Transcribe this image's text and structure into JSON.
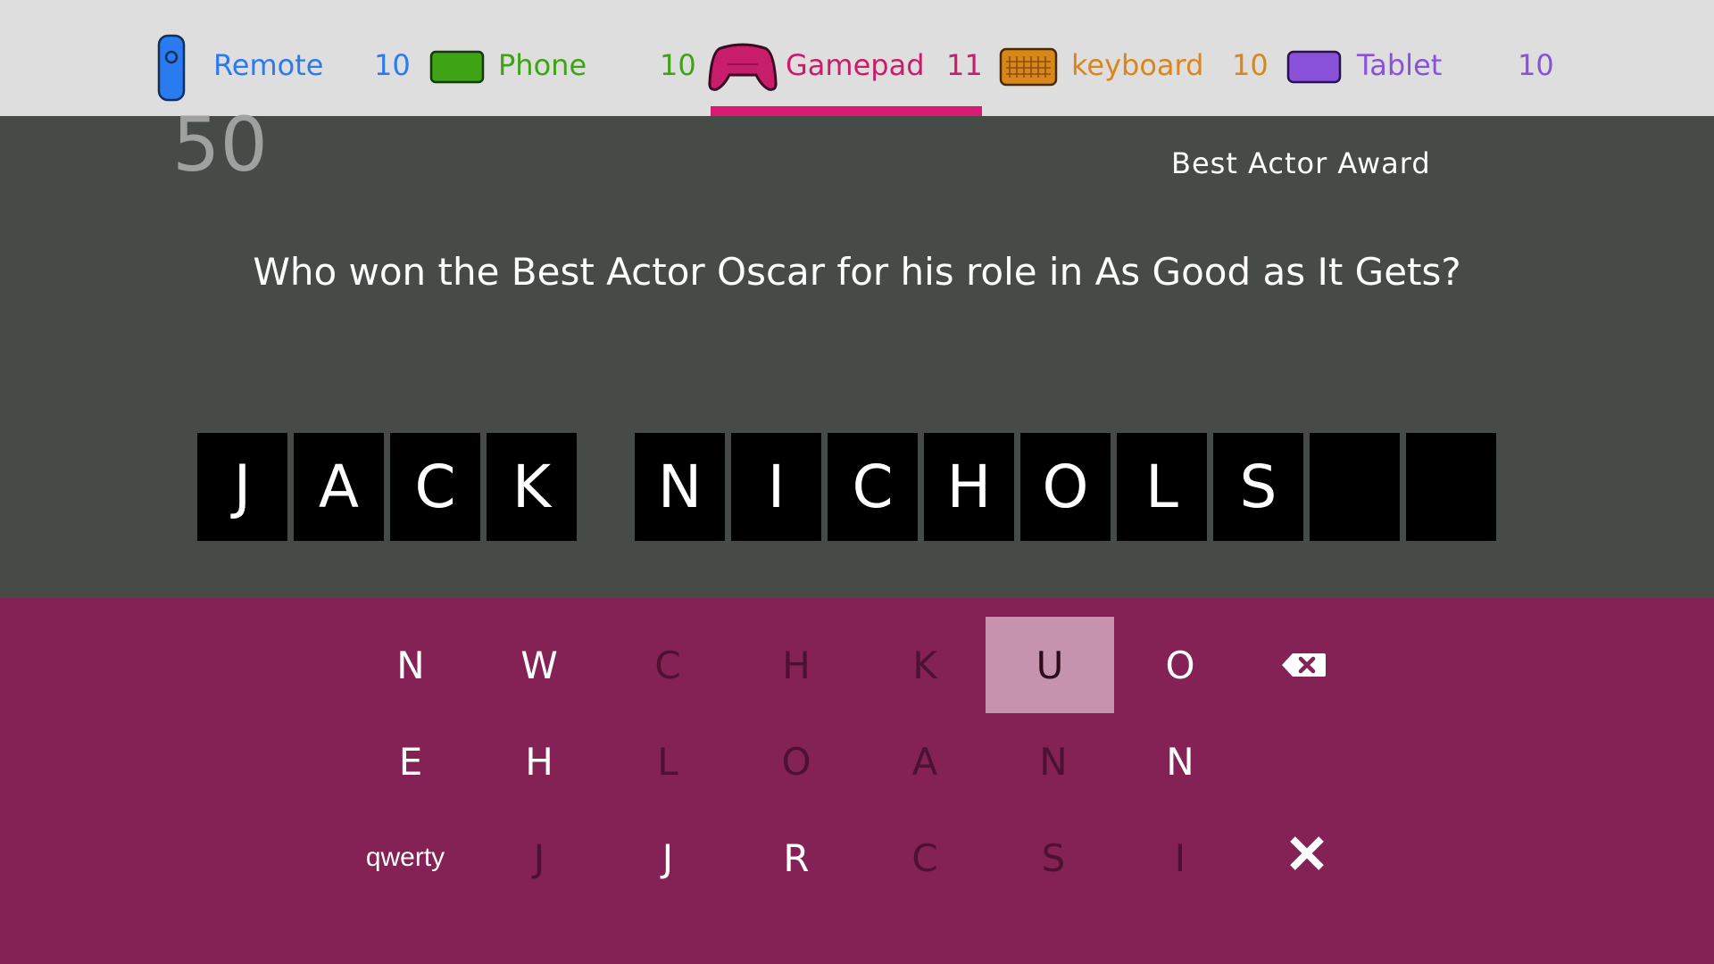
{
  "players": [
    {
      "name": "Remote",
      "score": "10",
      "color": "#2b7bf0",
      "icon": "remote-icon"
    },
    {
      "name": "Phone",
      "score": "10",
      "color": "#3fa316",
      "icon": "phone-icon"
    },
    {
      "name": "Gamepad",
      "score": "11",
      "color": "#c81d6b",
      "icon": "gamepad-icon"
    },
    {
      "name": "keyboard",
      "score": "10",
      "color": "#d9861a",
      "icon": "keyboard-icon"
    },
    {
      "name": "Tablet",
      "score": "10",
      "color": "#8a52d9",
      "icon": "tablet-icon"
    }
  ],
  "active_player": "Gamepad",
  "timer": "50",
  "category": "Best Actor Award",
  "question": "Who won the Best Actor Oscar for his role in As Good as It Gets?",
  "answer_tiles": [
    "J",
    "A",
    "C",
    "K",
    "",
    "N",
    "I",
    "C",
    "H",
    "O",
    "L",
    "S",
    "",
    ""
  ],
  "keyboard": {
    "rows": [
      [
        {
          "label": "N",
          "state": "on"
        },
        {
          "label": "W",
          "state": "on"
        },
        {
          "label": "C",
          "state": "off"
        },
        {
          "label": "H",
          "state": "off"
        },
        {
          "label": "K",
          "state": "off"
        },
        {
          "label": "U",
          "state": "selected"
        },
        {
          "label": "O",
          "state": "on"
        }
      ],
      [
        {
          "label": "E",
          "state": "on"
        },
        {
          "label": "H",
          "state": "on"
        },
        {
          "label": "L",
          "state": "off"
        },
        {
          "label": "O",
          "state": "off"
        },
        {
          "label": "A",
          "state": "off"
        },
        {
          "label": "N",
          "state": "off"
        },
        {
          "label": "N",
          "state": "on"
        }
      ],
      [
        {
          "label": "qwerty",
          "state": "on"
        },
        {
          "label": "J",
          "state": "off"
        },
        {
          "label": "J",
          "state": "on"
        },
        {
          "label": "R",
          "state": "on"
        },
        {
          "label": "C",
          "state": "off"
        },
        {
          "label": "S",
          "state": "off"
        },
        {
          "label": "I",
          "state": "off"
        }
      ]
    ],
    "backspace_icon": "backspace-icon",
    "close_icon": "close-icon"
  },
  "colors": {
    "topbar": "#dedede",
    "game_bg": "#464b48",
    "keyboard_bg": "#842155",
    "selected_key": "#c693ae",
    "accent": "#d81b72"
  }
}
